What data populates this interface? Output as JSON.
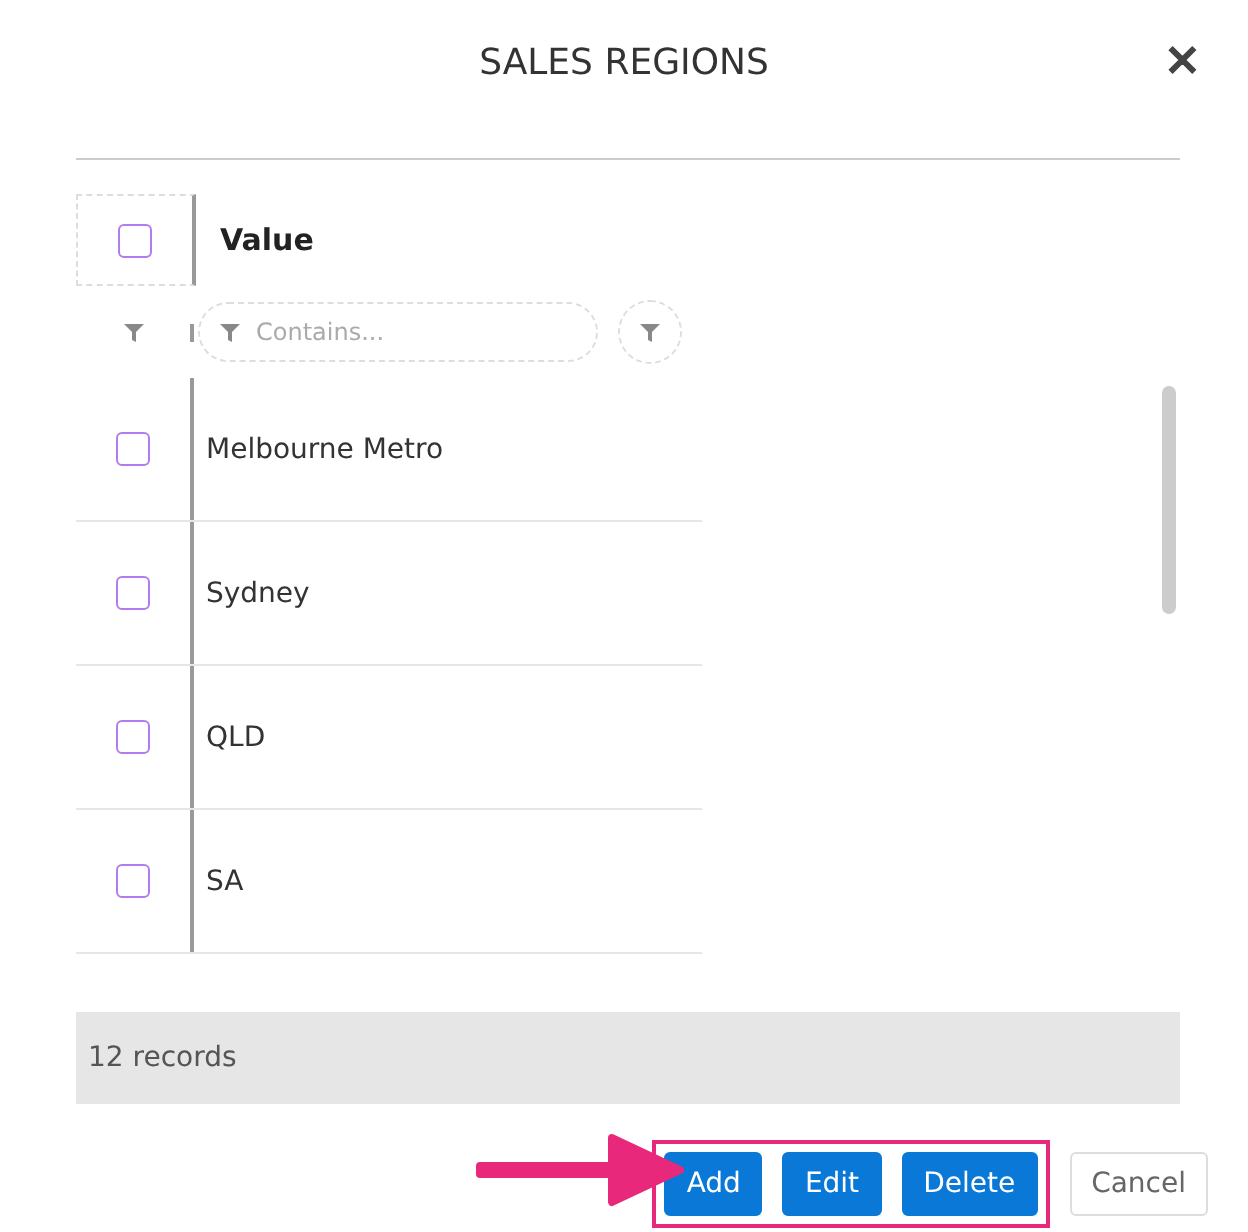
{
  "dialog": {
    "title": "SALES REGIONS",
    "close": "✕"
  },
  "grid": {
    "columns": [
      {
        "label": "Value"
      }
    ],
    "header_checked": false,
    "filter": {
      "placeholder": "Contains..."
    },
    "rows": [
      {
        "value": "Melbourne Metro",
        "checked": false
      },
      {
        "value": "Sydney",
        "checked": false
      },
      {
        "value": "QLD",
        "checked": false
      },
      {
        "value": "SA",
        "checked": false
      }
    ],
    "footer": "12 records"
  },
  "buttons": [
    {
      "label": "Add",
      "kind": "primary"
    },
    {
      "label": "Edit",
      "kind": "primary"
    },
    {
      "label": "Delete",
      "kind": "primary"
    },
    {
      "label": "Cancel",
      "kind": "secondary"
    }
  ]
}
